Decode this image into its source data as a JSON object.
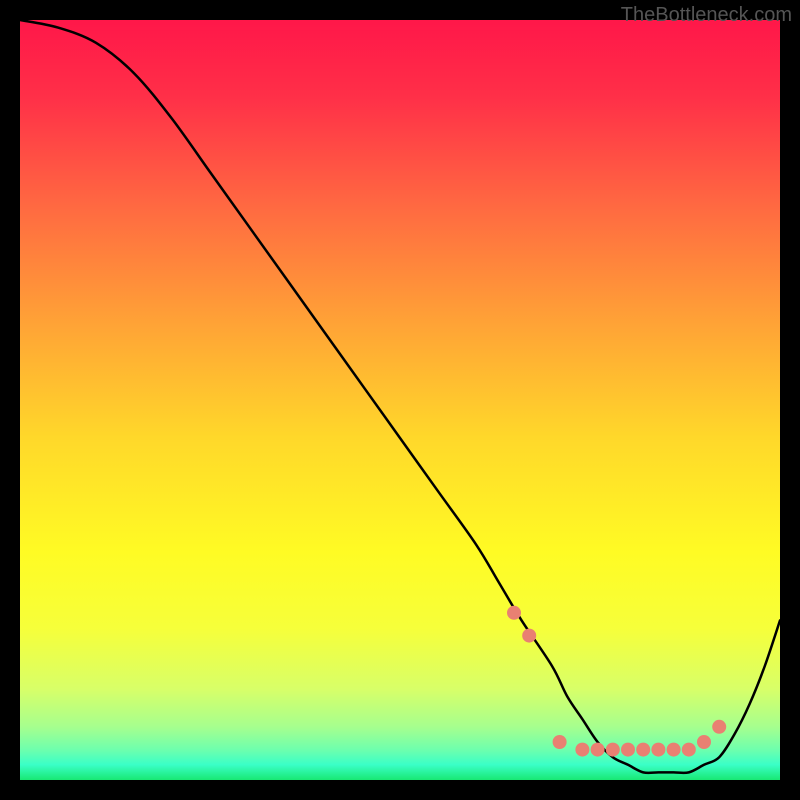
{
  "watermark": "TheBottleneck.com",
  "chart_data": {
    "type": "line",
    "title": "",
    "xlabel": "",
    "ylabel": "",
    "xlim": [
      0,
      100
    ],
    "ylim": [
      0,
      100
    ],
    "series": [
      {
        "name": "bottleneck-curve",
        "x": [
          0,
          5,
          10,
          15,
          20,
          25,
          30,
          35,
          40,
          45,
          50,
          55,
          60,
          63,
          66,
          70,
          72,
          74,
          76,
          78,
          80,
          82,
          84,
          86,
          88,
          90,
          92,
          94,
          96,
          98,
          100
        ],
        "values": [
          100,
          99,
          97,
          93,
          87,
          80,
          73,
          66,
          59,
          52,
          45,
          38,
          31,
          26,
          21,
          15,
          11,
          8,
          5,
          3,
          2,
          1,
          1,
          1,
          1,
          2,
          3,
          6,
          10,
          15,
          21
        ]
      }
    ],
    "markers": {
      "name": "highlight-dots",
      "x": [
        65,
        67,
        71,
        74,
        76,
        78,
        80,
        82,
        84,
        86,
        88,
        90,
        92
      ],
      "values": [
        22,
        19,
        5,
        4,
        4,
        4,
        4,
        4,
        4,
        4,
        4,
        5,
        7
      ],
      "color": "#e98072",
      "radius": 7
    },
    "gradient_stops": [
      {
        "offset": 0.0,
        "color": "#ff1749"
      },
      {
        "offset": 0.1,
        "color": "#ff2f48"
      },
      {
        "offset": 0.25,
        "color": "#ff6b41"
      },
      {
        "offset": 0.4,
        "color": "#ffa336"
      },
      {
        "offset": 0.55,
        "color": "#ffd82a"
      },
      {
        "offset": 0.7,
        "color": "#fffb24"
      },
      {
        "offset": 0.8,
        "color": "#f6ff3a"
      },
      {
        "offset": 0.88,
        "color": "#d8ff68"
      },
      {
        "offset": 0.93,
        "color": "#a6ff8e"
      },
      {
        "offset": 0.96,
        "color": "#6effad"
      },
      {
        "offset": 0.98,
        "color": "#3affc7"
      },
      {
        "offset": 1.0,
        "color": "#18e873"
      }
    ]
  }
}
